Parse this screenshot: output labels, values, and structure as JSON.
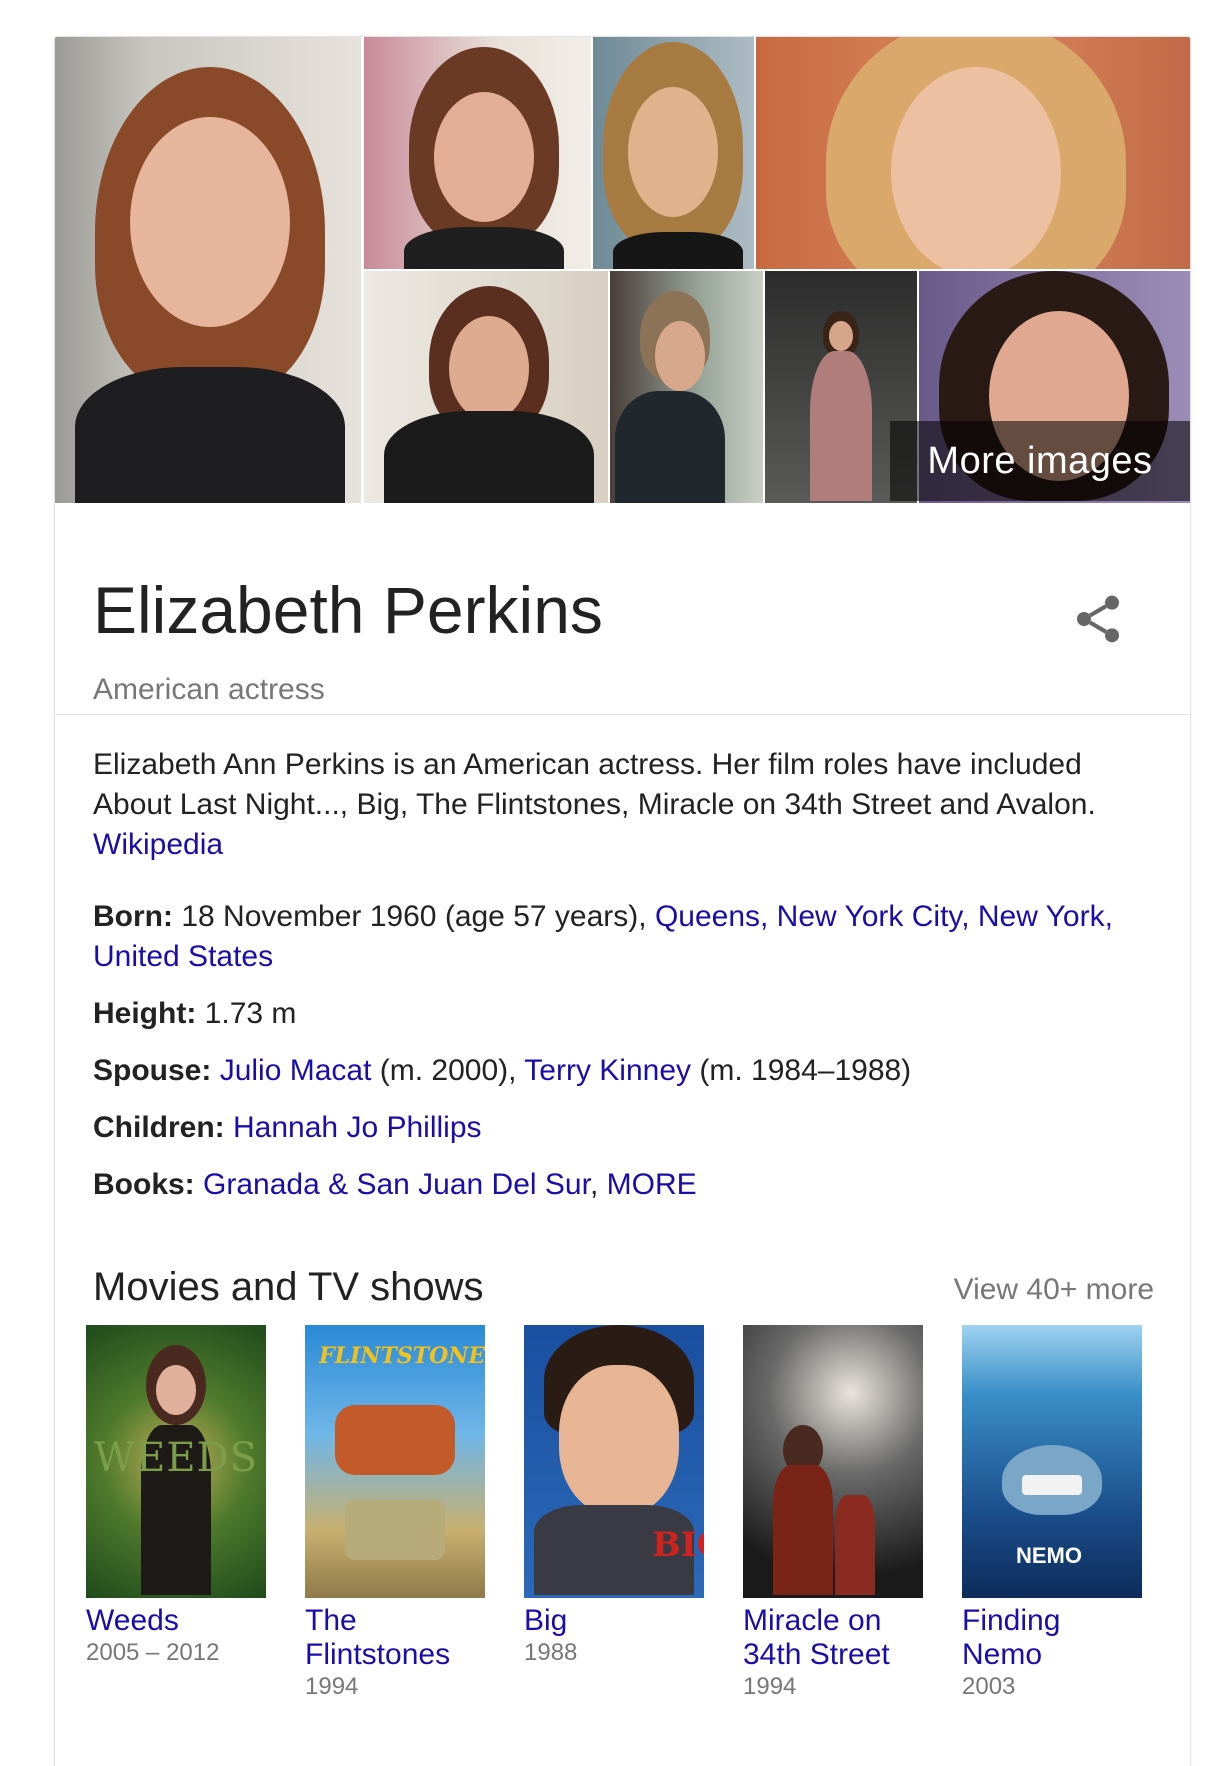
{
  "gallery": {
    "more_label": "More images"
  },
  "header": {
    "name": "Elizabeth Perkins",
    "subtitle": "American actress"
  },
  "description": {
    "text": "Elizabeth Ann Perkins is an American actress. Her film roles have included About Last Night..., Big, The Flintstones, Miracle on 34th Street and Avalon.",
    "source_link": "Wikipedia"
  },
  "facts": {
    "born": {
      "label": "Born:",
      "text": "18 November 1960 (age 57 years),",
      "link": "Queens, New York City, New York, United States"
    },
    "height": {
      "label": "Height:",
      "text": "1.73 m"
    },
    "spouse": {
      "label": "Spouse:",
      "link1": "Julio Macat",
      "text1": "(m. 2000),",
      "link2": "Terry Kinney",
      "text2": "(m. 1984–1988)"
    },
    "children": {
      "label": "Children:",
      "link": "Hannah Jo Phillips"
    },
    "books": {
      "label": "Books:",
      "link": "Granada & San Juan Del Sur",
      "sep": ",",
      "more": "MORE"
    }
  },
  "movies": {
    "title": "Movies and TV shows",
    "view_more": "View 40+ more",
    "items": [
      {
        "title": "Weeds",
        "year": "2005 – 2012",
        "poster_text": "WEEDS"
      },
      {
        "title": "The Flintstones",
        "year": "1994",
        "poster_text": "FLINTSTONES"
      },
      {
        "title": "Big",
        "year": "1988",
        "poster_text": "BIG"
      },
      {
        "title": "Miracle on 34th Street",
        "year": "1994",
        "poster_text": ""
      },
      {
        "title": "Finding Nemo",
        "year": "2003",
        "poster_text": "NEMO"
      }
    ]
  },
  "colors": {
    "link": "#1a0dab",
    "muted": "#777777",
    "text": "#222222"
  },
  "icons": {
    "share": "share-icon"
  }
}
